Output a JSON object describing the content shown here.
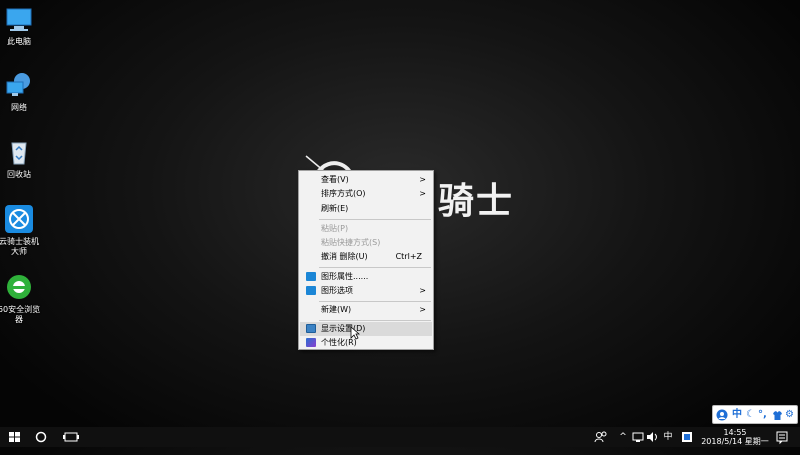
{
  "desktop": {
    "icons": [
      {
        "label": "此电脑"
      },
      {
        "label": "网络"
      },
      {
        "label": "回收站"
      },
      {
        "label_line1": "云骑士装机",
        "label_line2": "大师"
      },
      {
        "label_line1": "60安全浏览",
        "label_line2": "器"
      }
    ]
  },
  "wallpaper": {
    "logo_text": "骑士"
  },
  "context_menu": {
    "items": [
      {
        "label": "查看(V)",
        "has_submenu": true
      },
      {
        "label": "排序方式(O)",
        "has_submenu": true
      },
      {
        "label": "刷新(E)"
      },
      {
        "label": "粘贴(P)",
        "disabled": true
      },
      {
        "label": "粘贴快捷方式(S)",
        "disabled": true
      },
      {
        "label": "撤消 删除(U)",
        "shortcut": "Ctrl+Z"
      },
      {
        "label": "图形属性......",
        "icon": "graphics-properties-icon"
      },
      {
        "label": "图形选项",
        "icon": "graphics-options-icon",
        "has_submenu": true
      },
      {
        "label": "新建(W)",
        "has_submenu": true
      },
      {
        "label": "显示设置(D)",
        "icon": "display-settings-icon",
        "highlighted": true
      },
      {
        "label": "个性化(R)",
        "icon": "personalize-icon"
      }
    ]
  },
  "taskbar": {
    "ime_lang": "中",
    "clock_time": "14:55",
    "clock_date": "2018/5/14 星期一"
  },
  "ime_toolbar": {
    "lang": "中"
  },
  "colors": {
    "accent": "#0a74d4",
    "menu_bg": "#f2f2f2",
    "highlight": "#dadada"
  }
}
